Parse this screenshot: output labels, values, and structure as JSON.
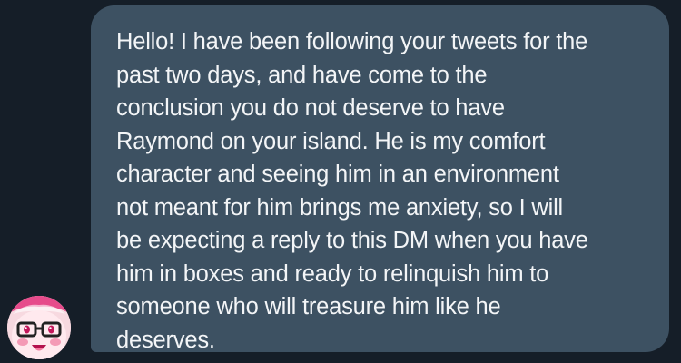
{
  "message": {
    "text": "Hello! I have been following your tweets for the\npast two days, and have come to the\nconclusion you do not deserve to have\nRaymond on your island. He is my comfort\ncharacter and seeing him in an environment\nnot meant for him brings me anxiety, so I will\nbe expecting a reply to this DM when you have\nhim in boxes and ready to relinquish him to\nsomeone who will treasure him like he\ndeserves."
  },
  "colors": {
    "background": "#151e28",
    "bubble": "#3d5162",
    "text": "#f3f5f7",
    "avatar_skin": "#f3c8d2",
    "avatar_accent": "#c2185b"
  },
  "avatar": {
    "icon": "user-avatar-icon"
  }
}
